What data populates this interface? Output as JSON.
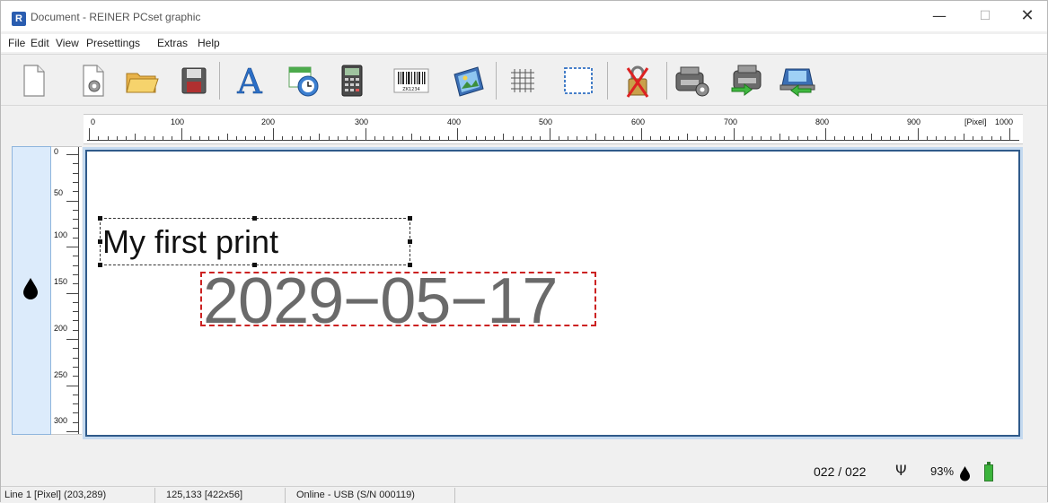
{
  "window": {
    "app_icon_letter": "R",
    "title": "Document - REINER PCset graphic",
    "minimize": "—",
    "maximize": "☐",
    "close": "✕"
  },
  "menu": [
    "File",
    "Edit",
    "View",
    "Presettings",
    "Extras",
    "Help"
  ],
  "toolbar": {
    "buttons": [
      {
        "name": "new-document-icon"
      },
      {
        "name": "new-from-template-icon"
      },
      {
        "name": "open-folder-icon"
      },
      {
        "name": "save-disk-icon"
      },
      {
        "name": "text-tool-icon",
        "glyph": "A"
      },
      {
        "name": "date-time-icon"
      },
      {
        "name": "counter-calculator-icon"
      },
      {
        "name": "barcode-icon",
        "caption": "ZK1234"
      },
      {
        "name": "image-icon"
      },
      {
        "name": "grid-icon"
      },
      {
        "name": "frame-icon"
      },
      {
        "name": "unlocked-icon"
      },
      {
        "name": "printer-settings-icon"
      },
      {
        "name": "send-to-printer-icon"
      },
      {
        "name": "load-from-printer-icon"
      }
    ]
  },
  "ruler": {
    "horizontal_labels": [
      "0",
      "100",
      "200",
      "300",
      "400",
      "500",
      "600",
      "700",
      "800",
      "900"
    ],
    "unit_label": "[Pixel]",
    "end_label": "1000",
    "vertical_labels": [
      "0",
      "50",
      "100",
      "150",
      "200",
      "250",
      "300"
    ]
  },
  "canvas": {
    "text_object": "My first print",
    "date_object": "2029−05−17"
  },
  "info": {
    "counter": "022 / 022",
    "usb_glyph": "Ψ",
    "ink_percent": "93%"
  },
  "status": {
    "line_position": "Line 1 [Pixel] (203,289)",
    "selection": "125,133 [422x56]",
    "connection": "Online - USB (S/N 000119)"
  },
  "colors": {
    "selection_border": "#cc2222",
    "canvas_border": "#2f5a8a",
    "battery": "#3cb43c"
  }
}
